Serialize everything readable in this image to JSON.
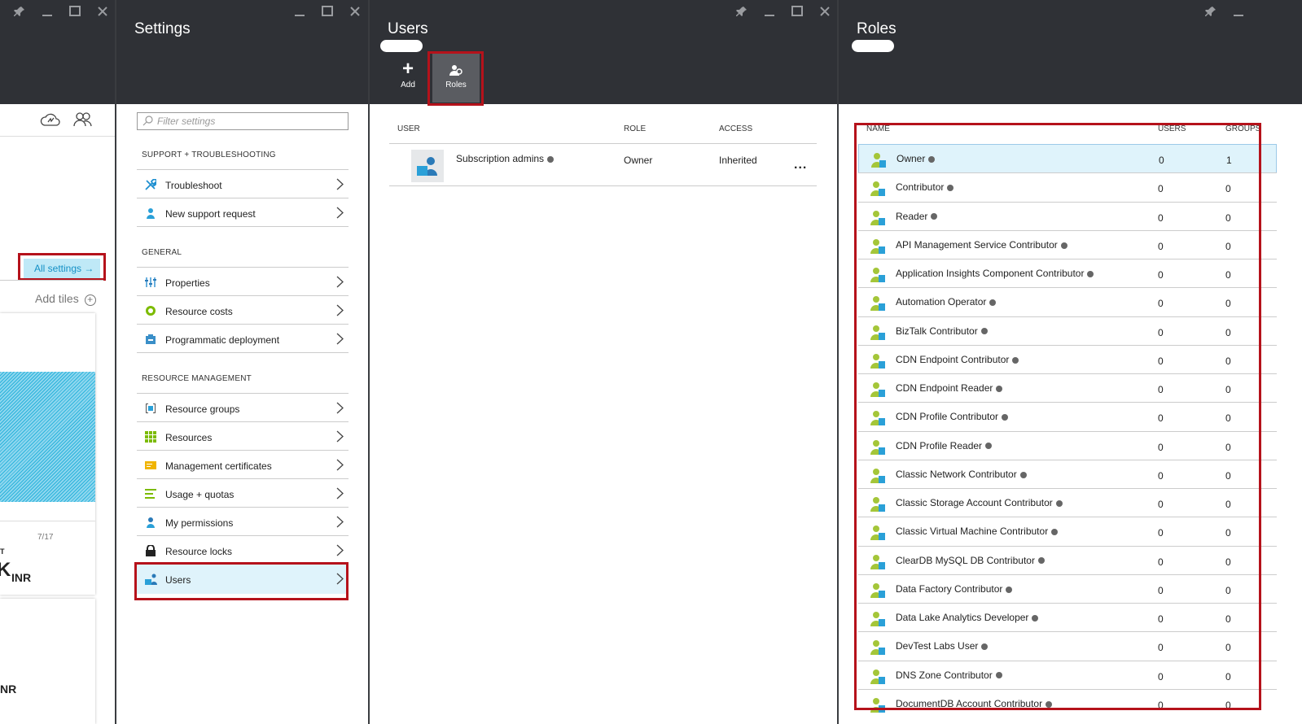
{
  "blade1": {
    "all_settings": "All settings",
    "add_tiles": "Add tiles",
    "date_tick": "7/17",
    "cost_label": "T",
    "currency1": "INR",
    "currency2": "NR"
  },
  "settings": {
    "title": "Settings",
    "filter_placeholder": "Filter settings",
    "sections": [
      {
        "title": "SUPPORT + TROUBLESHOOTING",
        "items": [
          "Troubleshoot",
          "New support request"
        ]
      },
      {
        "title": "GENERAL",
        "items": [
          "Properties",
          "Resource costs",
          "Programmatic deployment"
        ]
      },
      {
        "title": "RESOURCE MANAGEMENT",
        "items": [
          "Resource groups",
          "Resources",
          "Management certificates",
          "Usage + quotas",
          "My permissions",
          "Resource locks",
          "Users"
        ]
      }
    ]
  },
  "users": {
    "title": "Users",
    "toolbar": {
      "add": "Add",
      "roles": "Roles"
    },
    "columns": {
      "user": "USER",
      "role": "ROLE",
      "access": "ACCESS"
    },
    "rows": [
      {
        "user": "Subscription admins",
        "role": "Owner",
        "access": "Inherited"
      }
    ],
    "more": "..."
  },
  "roles": {
    "title": "Roles",
    "columns": {
      "name": "NAME",
      "users": "USERS",
      "groups": "GROUPS"
    },
    "rows": [
      {
        "name": "Owner",
        "users": "0",
        "groups": "1"
      },
      {
        "name": "Contributor",
        "users": "0",
        "groups": "0"
      },
      {
        "name": "Reader",
        "users": "0",
        "groups": "0"
      },
      {
        "name": "API Management Service Contributor",
        "users": "0",
        "groups": "0"
      },
      {
        "name": "Application Insights Component Contributor",
        "users": "0",
        "groups": "0"
      },
      {
        "name": "Automation Operator",
        "users": "0",
        "groups": "0"
      },
      {
        "name": "BizTalk Contributor",
        "users": "0",
        "groups": "0"
      },
      {
        "name": "CDN Endpoint Contributor",
        "users": "0",
        "groups": "0"
      },
      {
        "name": "CDN Endpoint Reader",
        "users": "0",
        "groups": "0"
      },
      {
        "name": "CDN Profile Contributor",
        "users": "0",
        "groups": "0"
      },
      {
        "name": "CDN Profile Reader",
        "users": "0",
        "groups": "0"
      },
      {
        "name": "Classic Network Contributor",
        "users": "0",
        "groups": "0"
      },
      {
        "name": "Classic Storage Account Contributor",
        "users": "0",
        "groups": "0"
      },
      {
        "name": "Classic Virtual Machine Contributor",
        "users": "0",
        "groups": "0"
      },
      {
        "name": "ClearDB MySQL DB Contributor",
        "users": "0",
        "groups": "0"
      },
      {
        "name": "Data Factory Contributor",
        "users": "0",
        "groups": "0"
      },
      {
        "name": "Data Lake Analytics Developer",
        "users": "0",
        "groups": "0"
      },
      {
        "name": "DevTest Labs User",
        "users": "0",
        "groups": "0"
      },
      {
        "name": "DNS Zone Contributor",
        "users": "0",
        "groups": "0"
      },
      {
        "name": "DocumentDB Account Contributor",
        "users": "0",
        "groups": "0"
      }
    ]
  },
  "colors": {
    "header": "#2f3136",
    "highlight": "#b5121b",
    "selected": "#dff3fb",
    "accent": "#1591c6"
  }
}
